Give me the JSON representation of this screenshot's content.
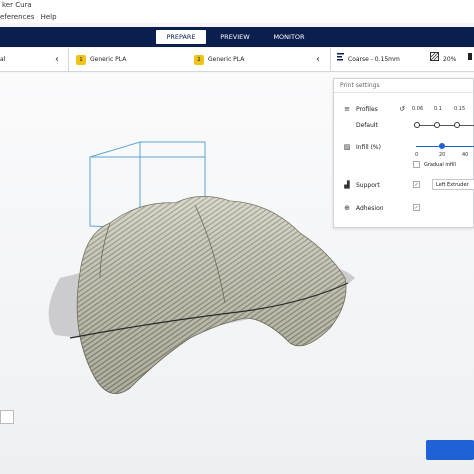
{
  "app": {
    "title": "ker Cura",
    "menu": [
      "eferences",
      "Help"
    ]
  },
  "stages": {
    "tabs": [
      "PREPARE",
      "PREVIEW",
      "MONITOR"
    ],
    "active": "PREPARE"
  },
  "toolbar": {
    "printer_fragment": "al",
    "extruder1": {
      "badge": "1",
      "material": "Generic PLA"
    },
    "extruder2": {
      "badge": "2",
      "material": "Generic PLA"
    },
    "profile": "Coarse - 0.15mm",
    "infill_pct": "20%"
  },
  "print_settings": {
    "header": "Print settings",
    "profiles_label": "Profiles",
    "default_label": "Default",
    "layer_ticks": [
      "0.06",
      "0.1",
      "0.15"
    ],
    "infill_label": "Infill (%)",
    "infill_ticks": [
      "0",
      "20",
      "40"
    ],
    "infill_value": 20,
    "gradual_infill_label": "Gradual infill",
    "support_label": "Support",
    "support_extruder": "Left Extruder",
    "adhesion_label": "Adhesion"
  },
  "icons": {
    "reset": "reset-icon",
    "profile": "profile-icon",
    "infill": "infill-icon",
    "support": "support-icon",
    "adhesion": "adhesion-icon"
  },
  "colors": {
    "stage_bar": "#0b1f4f",
    "accent": "#1e62d6",
    "pla": "#f0c419",
    "model": "#cfcdbb",
    "build_volume": "#5aa6d6"
  }
}
